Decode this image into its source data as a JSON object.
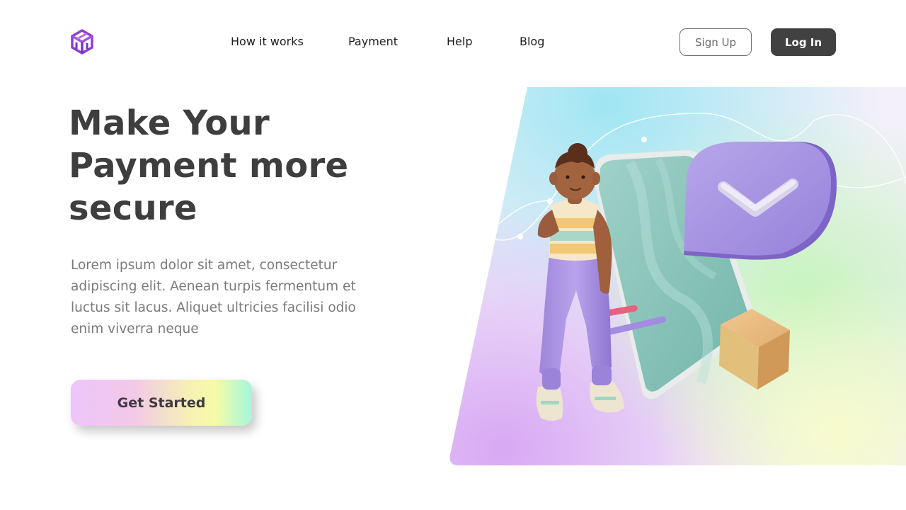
{
  "header": {
    "logo_icon": "cube-logo-icon",
    "nav": [
      {
        "label": "How it works"
      },
      {
        "label": "Payment"
      },
      {
        "label": "Help"
      },
      {
        "label": "Blog"
      }
    ],
    "sign_up_label": "Sign Up",
    "log_in_label": "Log In"
  },
  "hero": {
    "headline": [
      "Make Your",
      "Payment more",
      "secure"
    ],
    "description": "Lorem ipsum dolor sit amet, consectetur adipiscing elit. Aenean turpis fermentum et luctus sit lacus. Aliquet ultricies facilisi odio enim viverra neque",
    "cta_label": "Get Started",
    "illustration_icons": [
      "person-3d-illustration",
      "phone-illustration",
      "checkmark-bubble-icon",
      "box-icon"
    ]
  },
  "colors": {
    "brand_purple": "#8a3fd0",
    "text_dark": "#3e3e3e",
    "login_button": "#414141"
  }
}
